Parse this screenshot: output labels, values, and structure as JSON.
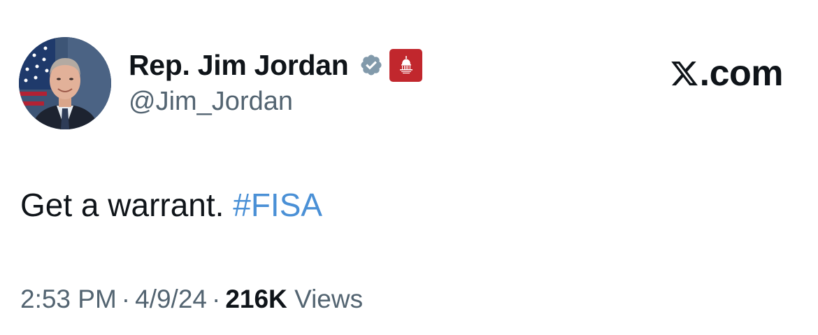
{
  "author": {
    "display_name": "Rep. Jim Jordan",
    "handle": "@Jim_Jordan",
    "verified_icon": "verified-badge-icon",
    "affiliation_icon": "capitol-dome-icon",
    "verified_color": "#829aab",
    "affiliation_color": "#c1272d"
  },
  "site": {
    "label": ".com",
    "logo_icon": "x-logo-icon"
  },
  "tweet": {
    "text": "Get a warrant. ",
    "hashtag": "#FISA",
    "hashtag_color": "#4a90d6"
  },
  "meta": {
    "time": "2:53 PM",
    "separator": "·",
    "date": "4/9/24",
    "views_count": "216K",
    "views_label": "Views"
  }
}
